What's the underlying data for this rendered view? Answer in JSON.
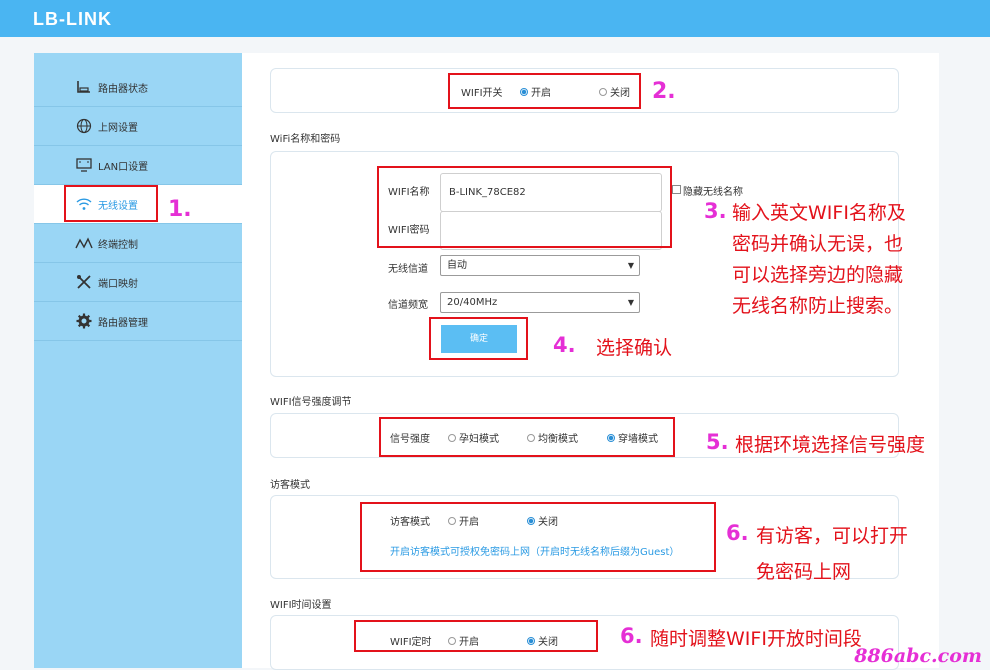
{
  "brand": {
    "logo": "LB-LINK"
  },
  "sidebar": {
    "items": [
      {
        "label": "路由器状态",
        "icon": "router-status-icon"
      },
      {
        "label": "上网设置",
        "icon": "globe-icon"
      },
      {
        "label": "LAN口设置",
        "icon": "monitor-icon"
      },
      {
        "label": "无线设置",
        "icon": "wifi-icon"
      },
      {
        "label": "终端控制",
        "icon": "activity-icon"
      },
      {
        "label": "端口映射",
        "icon": "tools-icon"
      },
      {
        "label": "路由器管理",
        "icon": "gear-icon"
      }
    ],
    "active_index": 3
  },
  "wifi_switch": {
    "label": "WIFI开关",
    "on": "开启",
    "off": "关闭",
    "selected": "on"
  },
  "name_pwd": {
    "title": "WiFi名称和密码",
    "name_label": "WIFI名称",
    "name_value": "B-LINK_78CE82",
    "hide_label": "隐藏无线名称",
    "pwd_label": "WIFI密码",
    "pwd_value": "",
    "channel_label": "无线信道",
    "channel_value": "自动",
    "bandwidth_label": "信道频宽",
    "bandwidth_value": "20/40MHz",
    "confirm": "确定"
  },
  "signal": {
    "title": "WIFI信号强度调节",
    "label": "信号强度",
    "opt1": "孕妇模式",
    "opt2": "均衡模式",
    "opt3": "穿墙模式",
    "selected": 3
  },
  "guest": {
    "title": "访客模式",
    "label": "访客模式",
    "on": "开启",
    "off": "关闭",
    "selected": "off",
    "note": "开启访客模式可授权免密码上网（开启时无线名称后缀为Guest）"
  },
  "timer": {
    "title": "WIFI时间设置",
    "label": "WIFI定时",
    "on": "开启",
    "off": "关闭",
    "selected": "off"
  },
  "annotations": {
    "a1": "1.",
    "a2": "2.",
    "a3_num": "3.",
    "a3_l1": "输入英文WIFI名称及",
    "a3_l2": "密码并确认无误，也",
    "a3_l3": "可以选择旁边的隐藏",
    "a3_l4": "无线名称防止搜索。",
    "a4_num": "4.",
    "a4_text": "选择确认",
    "a5_num": "5.",
    "a5_text": "根据环境选择信号强度",
    "a6_num": "6.",
    "a6_l1": "有访客，可以打开",
    "a6_l2": "免密码上网",
    "a7_num": "6.",
    "a7_text": "随时调整WIFI开放时间段"
  },
  "watermark": "886abc.com",
  "colors": {
    "topbar": "#4ab5f2",
    "sidebar": "#9ad6f5",
    "accent": "#2a8fd6",
    "annotation": "#e3121b",
    "number": "#e52fd5"
  }
}
